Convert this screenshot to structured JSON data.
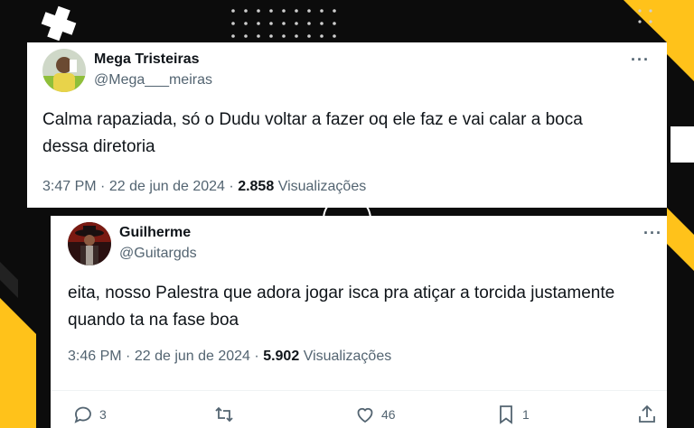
{
  "colors": {
    "accent_yellow": "#ffc21a",
    "background": "#0c0c0c",
    "text_secondary": "#536471"
  },
  "tweets": [
    {
      "name": "Mega Tristeiras",
      "handle": "@Mega___meiras",
      "text_line1": "Calma rapaziada, só o Dudu voltar a fazer oq ele faz e vai calar a boca",
      "text_line2": "dessa diretoria",
      "time": "3:47 PM",
      "sep1": "·",
      "date": "22 de jun de 2024",
      "sep2": "·",
      "views": "2.858",
      "views_label": "Visualizações",
      "more": "···"
    },
    {
      "name": "Guilherme",
      "handle": "@Guitargds",
      "text_line1": "eita, nosso Palestra que adora jogar isca pra atiçar a torcida justamente",
      "text_line2": "quando ta na fase boa",
      "time": "3:46 PM",
      "sep1": "·",
      "date": "22 de jun de 2024",
      "sep2": "·",
      "views": "5.902",
      "views_label": "Visualizações",
      "more": "···",
      "replies": "3",
      "retweets": "",
      "likes": "46",
      "bookmarks": "1"
    }
  ]
}
